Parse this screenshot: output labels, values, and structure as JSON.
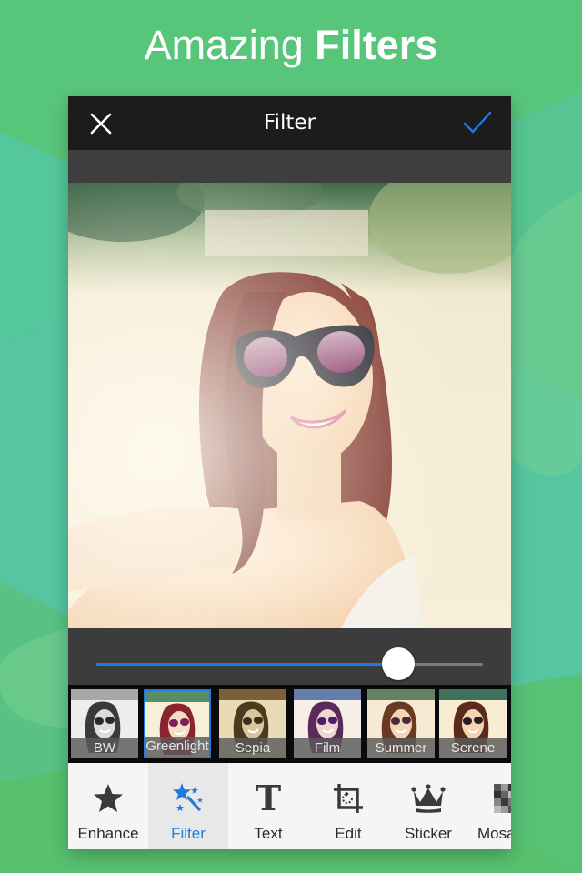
{
  "headline": {
    "regular": "Amazing ",
    "bold": "Filters"
  },
  "topbar": {
    "title": "Filter",
    "close_icon": "close-icon",
    "confirm_icon": "checkmark-icon"
  },
  "photo": {
    "description": "Woman with red hair wearing sunglasses taking a selfie on a sunny beach"
  },
  "intensity_slider": {
    "value_percent": 78
  },
  "filters": [
    {
      "label": "BW",
      "selected": false
    },
    {
      "label": "Greenlight",
      "selected": true
    },
    {
      "label": "Sepia",
      "selected": false
    },
    {
      "label": "Film",
      "selected": false
    },
    {
      "label": "Summer",
      "selected": false
    },
    {
      "label": "Serene",
      "selected": false
    }
  ],
  "tools": [
    {
      "label": "Enhance",
      "icon": "star-icon",
      "active": false
    },
    {
      "label": "Filter",
      "icon": "magic-wand-icon",
      "active": true
    },
    {
      "label": "Text",
      "icon": "text-icon",
      "active": false
    },
    {
      "label": "Edit",
      "icon": "crop-rotate-icon",
      "active": false
    },
    {
      "label": "Sticker",
      "icon": "crown-icon",
      "active": false
    },
    {
      "label": "Mosaic",
      "icon": "mosaic-icon",
      "active": false
    }
  ],
  "colors": {
    "accent": "#1f7be0",
    "background": "#58c67a",
    "topbar": "#1c1c1c",
    "panel": "#3c3c3c"
  }
}
